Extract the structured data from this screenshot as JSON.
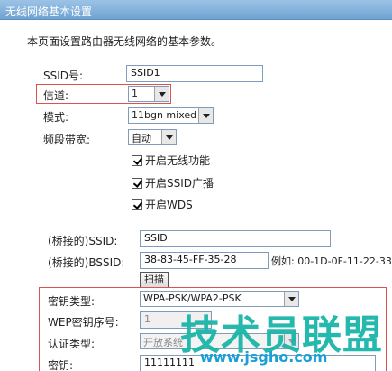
{
  "window": {
    "title": "无线网络基本设置"
  },
  "description": "本页面设置路由器无线网络的基本参数。",
  "fields": {
    "ssid": {
      "label": "SSID号:",
      "value": "SSID1"
    },
    "channel": {
      "label": "信道:",
      "value": "1"
    },
    "mode": {
      "label": "模式:",
      "value": "11bgn mixed"
    },
    "bandwidth": {
      "label": "频段带宽:",
      "value": "自动"
    }
  },
  "checkboxes": [
    {
      "label": "开启无线功能",
      "checked": true
    },
    {
      "label": "开启SSID广播",
      "checked": true
    },
    {
      "label": "开启WDS",
      "checked": true
    }
  ],
  "wds": {
    "ssid_label": "(桥接的)SSID:",
    "ssid_value": "SSID",
    "bssid_label": "(桥接的)BSSID:",
    "bssid_value": "38-83-45-FF-35-28",
    "example": "例如: 00-1D-0F-11-22-33",
    "scan_button": "扫描"
  },
  "security": {
    "key_type_label": "密钥类型:",
    "key_type_value": "WPA-PSK/WPA2-PSK",
    "wep_index_label": "WEP密钥序号:",
    "wep_index_value": "1",
    "auth_type_label": "认证类型:",
    "auth_type_value": "开放系统",
    "key_label": "密钥:",
    "key_value": "11111111"
  },
  "watermark": {
    "brand": "技术员联盟",
    "url": "www.jsgho.com"
  },
  "colors": {
    "highlight": "#d9534f",
    "titlebar": "#7fb0dc",
    "watermark": "#19b6a8"
  }
}
